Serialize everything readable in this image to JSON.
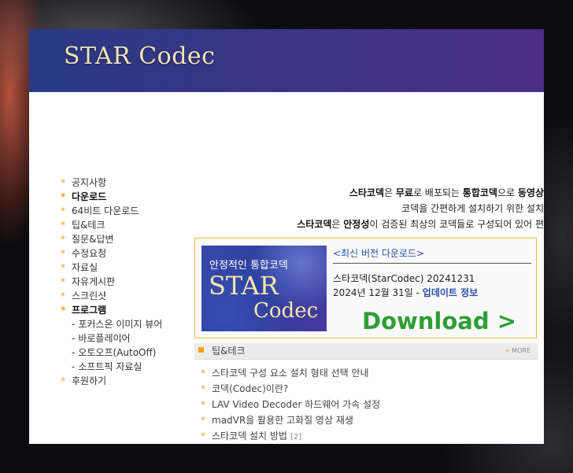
{
  "site": {
    "title": "STAR Codec"
  },
  "menu": [
    {
      "label": "공지사항",
      "bold": false
    },
    {
      "label": "다운로드",
      "bold": true
    },
    {
      "label": "64비트 다운로드",
      "bold": false
    },
    {
      "label": "팁&테크",
      "bold": false
    },
    {
      "label": "질문&답변",
      "bold": false
    },
    {
      "label": "수정요청",
      "bold": false
    },
    {
      "label": "자료실",
      "bold": false
    },
    {
      "label": "자유게시판",
      "bold": false
    },
    {
      "label": "스크린샷",
      "bold": false
    },
    {
      "label": "프로그램",
      "bold": true
    }
  ],
  "submenu": [
    {
      "label": "포커스온 이미지 뷰어"
    },
    {
      "label": "바로플레이어"
    },
    {
      "label": "오토오프(AutoOff)"
    },
    {
      "label": "소프트픽 자료실"
    }
  ],
  "menu_last": {
    "label": "후원하기"
  },
  "intro": {
    "l1_a": "스타코덱",
    "l1_b": "은 ",
    "l1_c": "무료",
    "l1_d": "로 배포되는 ",
    "l1_e": "통합코덱",
    "l1_f": "으로 ",
    "l1_g": "동영상",
    "l2": "코덱을 간편하게 설치하기 위한 설치",
    "l3_a": "스타코덱",
    "l3_b": "은 ",
    "l3_c": "안정성",
    "l3_d": "이 검증된 최상의 코덱들로 구성되어 있어 편"
  },
  "download": {
    "banner_line1": "안정적인 통합코덱",
    "banner_line2": "STAR",
    "banner_line3": "Codec",
    "heading": "<최신 버전 다운로드>",
    "version": "스타코덱(StarCodec) 20241231",
    "date": "2024년 12월 31일 - ",
    "update_link": "업데이트 정보",
    "button": "Download >"
  },
  "tips": {
    "title": "팁&테크",
    "more_label": "MORE",
    "items": [
      {
        "label": "스타코덱 구성 요소 설치 형태 선택 안내",
        "count": ""
      },
      {
        "label": "코덱(Codec)이란?",
        "count": ""
      },
      {
        "label": "LAV Video Decoder 하드웨어 가속 설정",
        "count": ""
      },
      {
        "label": "madVR을 활용한 고화질 영상 재생",
        "count": ""
      },
      {
        "label": "스타코덱 설치 방법",
        "count": "[2]"
      }
    ]
  },
  "colors": {
    "accent": "#f0a020",
    "link": "#2b4fa8",
    "download": "#2e9e35",
    "header": "#3a3585"
  }
}
